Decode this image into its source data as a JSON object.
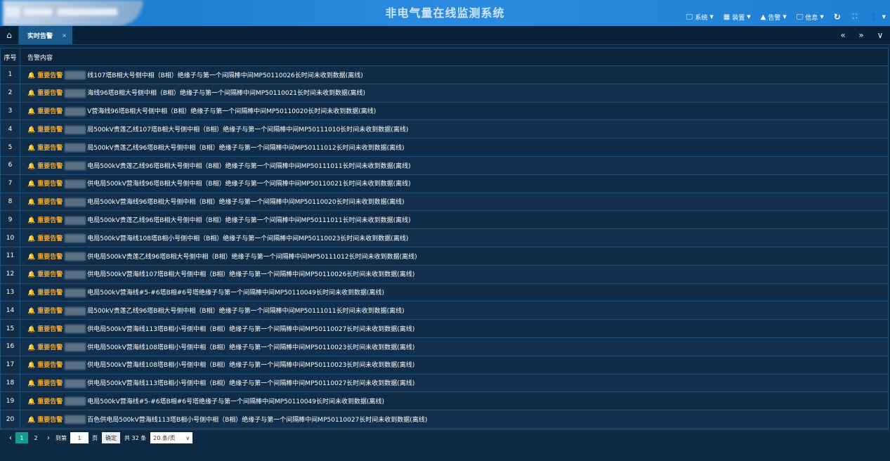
{
  "header": {
    "title": "非电气量在线监测系统",
    "menu": [
      {
        "icon": "monitor-icon",
        "glyph": "🖵",
        "label": "系统"
      },
      {
        "icon": "device-icon",
        "glyph": "▦",
        "label": "装置"
      },
      {
        "icon": "alert-icon",
        "glyph": "▲",
        "label": "告警"
      },
      {
        "icon": "monitor-icon",
        "glyph": "🖵",
        "label": "信息"
      }
    ],
    "refresh_glyph": "↻",
    "fullscreen_glyph": "⛶",
    "user_glyph": "👤"
  },
  "tabs": {
    "home_glyph": "⌂",
    "items": [
      {
        "label": "实时告警",
        "close": "×"
      }
    ],
    "prev_glyph": "«",
    "next_glyph": "»",
    "more_glyph": "∨"
  },
  "table": {
    "headers": [
      "序号",
      "告警内容"
    ],
    "level": "重要告警",
    "rows": [
      {
        "no": "1",
        "text": "线107塔B相大号侧中相（B相）绝缘子与第一个间隔棒中间MP50110026长时间未收到数据(离线)"
      },
      {
        "no": "2",
        "text": "海线96塔B相大号侧中相（B相）绝缘子与第一个间隔棒中间MP50110021长时间未收到数据(离线)"
      },
      {
        "no": "3",
        "text": "V营海线96塔B相大号侧中相（B相）绝缘子与第一个间隔棒中间MP50110020长时间未收到数据(离线)"
      },
      {
        "no": "4",
        "text": "局500kV贵莲乙线107塔B相大号侧中相（B相）绝缘子与第一个间隔棒中间MP50111010长时间未收到数据(离线)"
      },
      {
        "no": "5",
        "text": "局500kV贵莲乙线96塔B相大号侧中相（B相）绝缘子与第一个间隔棒中间MP50111012长时间未收到数据(离线)"
      },
      {
        "no": "6",
        "text": "电局500kV贵莲乙线96塔B相大号侧中相（B相）绝缘子与第一个间隔棒中间MP50111011长时间未收到数据(离线)"
      },
      {
        "no": "7",
        "text": "供电局500kV营海线96塔B相大号侧中相（B相）绝缘子与第一个间隔棒中间MP50110021长时间未收到数据(离线)"
      },
      {
        "no": "8",
        "text": "电局500kV营海线96塔B相大号侧中相（B相）绝缘子与第一个间隔棒中间MP50110020长时间未收到数据(离线)"
      },
      {
        "no": "9",
        "text": "电局500kV贵莲乙线96塔B相大号侧中相（B相）绝缘子与第一个间隔棒中间MP50111011长时间未收到数据(离线)"
      },
      {
        "no": "10",
        "text": "电局500kV营海线108塔B相小号侧中相（B相）绝缘子与第一个间隔棒中间MP50110023长时间未收到数据(离线)"
      },
      {
        "no": "11",
        "text": "供电局500kV贵莲乙线96塔B相大号侧中相（B相）绝缘子与第一个间隔棒中间MP50111012长时间未收到数据(离线)"
      },
      {
        "no": "12",
        "text": "供电局500kV营海线107塔B相大号侧中相（B相）绝缘子与第一个间隔棒中间MP50110026长时间未收到数据(离线)"
      },
      {
        "no": "13",
        "text": "电局500kV营海线#5-#6塔B相#6号塔绝缘子与第一个间隔棒中间MP50110049长时间未收到数据(离线)"
      },
      {
        "no": "14",
        "text": "局500kV贵莲乙线96塔B相大号侧中相（B相）绝缘子与第一个间隔棒中间MP50111011长时间未收到数据(离线)"
      },
      {
        "no": "15",
        "text": "供电局500kV营海线113塔B相小号侧中相（B相）绝缘子与第一个间隔棒中间MP50110027长时间未收到数据(离线)"
      },
      {
        "no": "16",
        "text": "供电局500kV营海线108塔B相小号侧中相（B相）绝缘子与第一个间隔棒中间MP50110023长时间未收到数据(离线)"
      },
      {
        "no": "17",
        "text": "供电局500kV营海线108塔B相小号侧中相（B相）绝缘子与第一个间隔棒中间MP50110023长时间未收到数据(离线)"
      },
      {
        "no": "18",
        "text": "供电局500kV营海线113塔B相小号侧中相（B相）绝缘子与第一个间隔棒中间MP50110027长时间未收到数据(离线)"
      },
      {
        "no": "19",
        "text": "电局500kV营海线#5-#6塔B相#6号塔绝缘子与第一个间隔棒中间MP50110049长时间未收到数据(离线)"
      },
      {
        "no": "20",
        "text": "百色供电局500kV营海线113塔B相小号侧中相（B相）绝缘子与第一个间隔棒中间MP50110027长时间未收到数据(离线)"
      }
    ]
  },
  "pager": {
    "prev": "‹",
    "pages": [
      "1",
      "2"
    ],
    "next": "›",
    "goto_label": "到第",
    "goto_value": "1",
    "page_label": "页",
    "confirm": "确定",
    "total": "共 32 条",
    "page_size": "20 条/页",
    "page_size_caret": "∨"
  },
  "colors": {
    "header": "#2a8be0",
    "alert": "#f0a830",
    "active_page": "#169c8f"
  }
}
